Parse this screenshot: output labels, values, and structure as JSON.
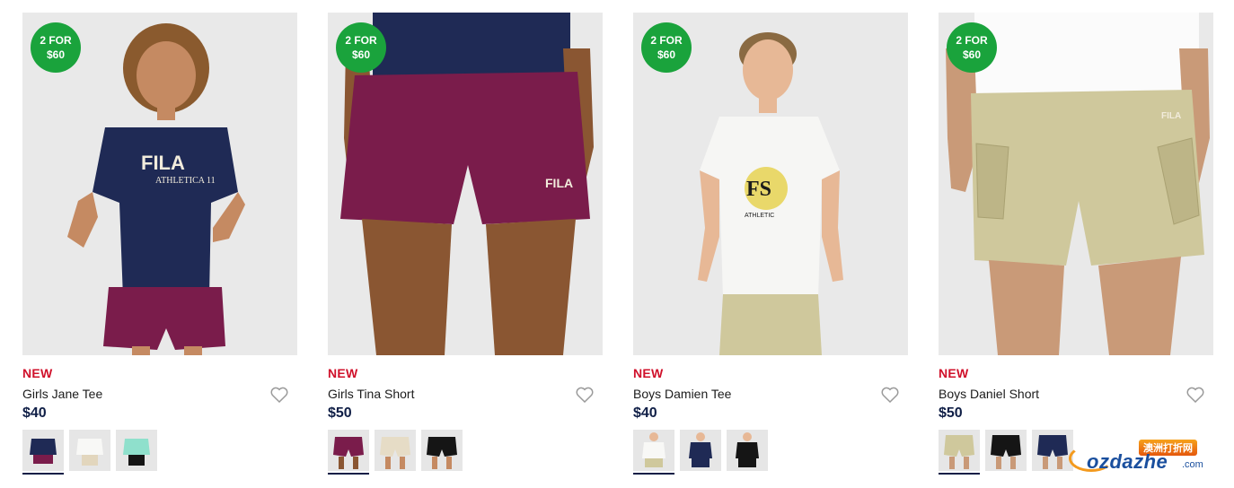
{
  "products": [
    {
      "promo": [
        "2 FOR",
        "$60"
      ],
      "tag": "NEW",
      "name": "Girls Jane Tee",
      "price": "$40",
      "swatches": [
        "navy tee",
        "white tee",
        "mint tee"
      ],
      "swatch_colors": [
        "#1f2a55",
        "#f4f4f2",
        "#8fe0cc"
      ]
    },
    {
      "promo": [
        "2 FOR",
        "$60"
      ],
      "tag": "NEW",
      "name": "Girls Tina Short",
      "price": "$50",
      "swatches": [
        "plum short",
        "cream short",
        "black short"
      ],
      "swatch_colors": [
        "#7a1c4b",
        "#e6dcc6",
        "#151515"
      ]
    },
    {
      "promo": [
        "2 FOR",
        "$60"
      ],
      "tag": "NEW",
      "name": "Boys Damien Tee",
      "price": "$40",
      "swatches": [
        "white tee",
        "navy tee",
        "black tee"
      ],
      "swatch_colors": [
        "#f6f6f4",
        "#1f2a55",
        "#151515"
      ]
    },
    {
      "promo": [
        "2 FOR",
        "$60"
      ],
      "tag": "NEW",
      "name": "Boys Daniel Short",
      "price": "$50",
      "swatches": [
        "khaki short",
        "black short",
        "navy short"
      ],
      "swatch_colors": [
        "#cfc89c",
        "#151515",
        "#1f2a55"
      ]
    }
  ],
  "watermark": {
    "top": "澳洲打折网",
    "main": "ozdazhe",
    "suffix": ".com"
  },
  "colors": {
    "promo": "#1aa33c",
    "new_tag": "#d0112b",
    "price": "#0f1e46"
  }
}
